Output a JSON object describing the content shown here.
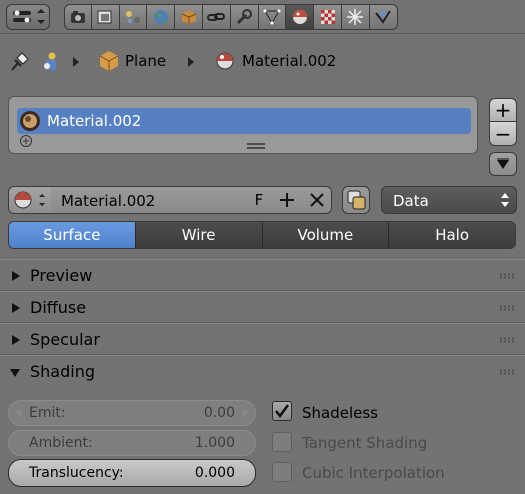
{
  "header": {
    "editor_type_icon": "properties-editor-icon",
    "context_tabs": [
      "render-icon",
      "render-layers-icon",
      "scene-icon",
      "world-icon",
      "object-icon",
      "constraints-icon",
      "modifiers-icon",
      "object-data-icon",
      "material-icon",
      "texture-icon",
      "particles-icon",
      "physics-icon"
    ],
    "active_tab": "material"
  },
  "breadcrumb": {
    "pin_icon": "pin-icon",
    "items": [
      {
        "icon": "object-node-icon",
        "label": ""
      },
      {
        "icon": "mesh-cube-icon",
        "label": "Plane"
      },
      {
        "icon": "material-sphere-icon",
        "label": "Material.002"
      }
    ]
  },
  "slots": {
    "items": [
      {
        "label": "Material.002"
      }
    ],
    "add_label": "+",
    "remove_label": "−"
  },
  "material_id": {
    "name": "Material.002",
    "fake_user_label": "F",
    "link_options": [
      "Data"
    ],
    "link_selected": "Data"
  },
  "tabs": [
    {
      "label": "Surface"
    },
    {
      "label": "Wire"
    },
    {
      "label": "Volume"
    },
    {
      "label": "Halo"
    }
  ],
  "panels": [
    {
      "title": "Preview",
      "open": false
    },
    {
      "title": "Diffuse",
      "open": false
    },
    {
      "title": "Specular",
      "open": false
    },
    {
      "title": "Shading",
      "open": true
    }
  ],
  "shading": {
    "emit": {
      "label": "Emit:",
      "value": "0.00"
    },
    "ambient": {
      "label": "Ambient:",
      "value": "1.000"
    },
    "translucency": {
      "label": "Translucency:",
      "value": "0.000"
    },
    "shadeless": {
      "label": "Shadeless",
      "checked": true
    },
    "tangent_shading": {
      "label": "Tangent Shading",
      "checked": false
    },
    "cubic_interpolation": {
      "label": "Cubic Interpolation",
      "checked": false
    }
  },
  "colors": {
    "accent": "#5680c2",
    "panel": "#737373",
    "background": "#727272"
  }
}
